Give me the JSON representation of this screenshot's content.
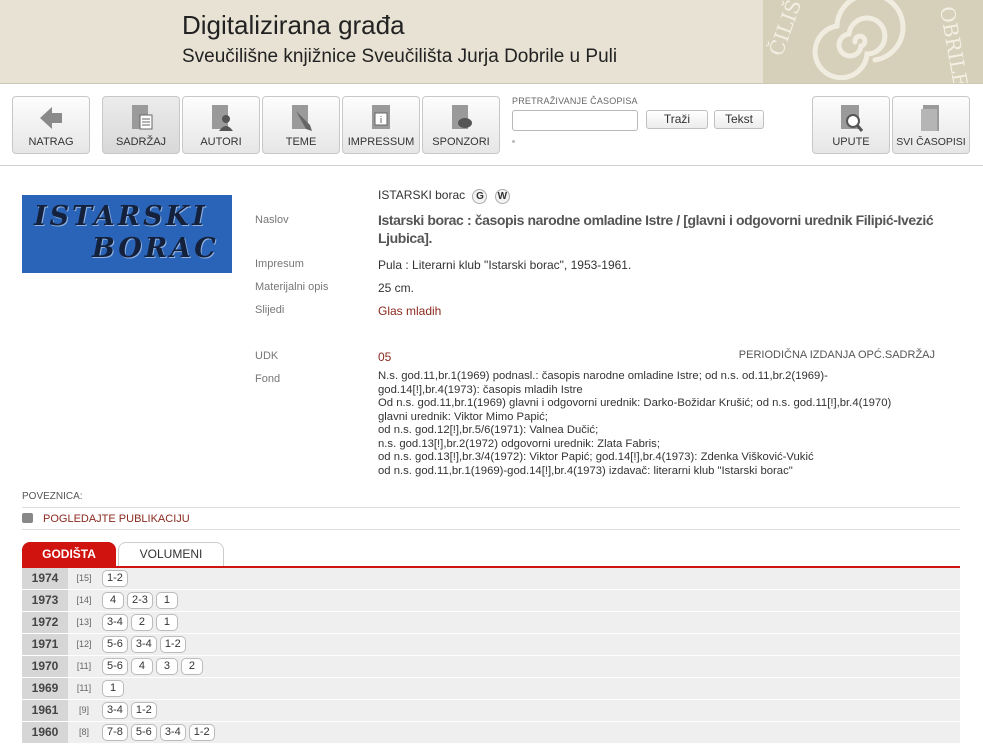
{
  "header": {
    "title": "Digitalizirana građa",
    "subtitle": "Sveučilišne knjižnice Sveučilišta Jurja Dobrile u Puli",
    "logo_text_1": "ČILIŠ",
    "logo_text_2": "OBRILE U"
  },
  "toolbar": {
    "buttons": [
      {
        "label": "NATRAG",
        "icon": "back-arrow-icon"
      },
      {
        "label": "SADRŽAJ",
        "icon": "contents-icon"
      },
      {
        "label": "AUTORI",
        "icon": "authors-icon"
      },
      {
        "label": "TEME",
        "icon": "topics-icon"
      },
      {
        "label": "IMPRESSUM",
        "icon": "info-icon"
      },
      {
        "label": "SPONZORI",
        "icon": "sponsors-icon"
      },
      {
        "label": "UPUTE",
        "icon": "help-icon"
      },
      {
        "label": "SVI ČASOPISI",
        "icon": "journals-icon"
      }
    ],
    "search": {
      "label": "PRETRAŽIVANJE ČASOPISA",
      "value": "",
      "search_button": "Traži",
      "text_button": "Tekst"
    }
  },
  "record": {
    "short_title": "ISTARSKI borac",
    "badge_g": "G",
    "badge_w": "W",
    "cover_line1": "ISTARSKI",
    "cover_line2": "BORAC",
    "fields": {
      "naslov_label": "Naslov",
      "naslov": "Istarski borac : časopis narodne omladine Istre / [glavni i odgovorni urednik Filipić-Ivezić Ljubica].",
      "impresum_label": "Impresum",
      "impresum": "Pula : Literarni klub \"Istarski borac\", 1953-1961.",
      "materijalni_label": "Materijalni opis",
      "materijalni": "25 cm.",
      "slijedi_label": "Slijedi",
      "slijedi": "Glas mladih",
      "udk_label": "UDK",
      "udk": "05",
      "udk_desc": "PERIODIČNA IZDANJA OPĆ.SADRŽAJ",
      "fond_label": "Fond",
      "fond": "N.s. god.11,br.1(1969) podnasl.: časopis narodne omladine Istre; od n.s. od.11,br.2(1969)-\ngod.14[!],br.4(1973): časopis mladih Istre\nOd n.s. god.11,br.1(1969) glavni i odgovorni urednik: Darko-Božidar Krušić; od n.s. god.11[!],br.4(1970)\nglavni urednik: Viktor Mimo Papić;\nod n.s. god.12[!],br.5/6(1971): Valnea Dučić;\nn.s. god.13[!],br.2(1972) odgovorni urednik: Zlata Fabris;\nod n.s. god.13[!],br.3/4(1972): Viktor Papić; god.14[!],br.4(1973): Zdenka Višković-Vukić\nod n.s. god.11,br.1(1969)-god.14[!],br.4(1973) izdavač: literarni klub \"Istarski borac\""
    },
    "poveznica_label": "POVEZNICA:",
    "view_publication": "POGLEDAJTE PUBLIKACIJU"
  },
  "tabs": {
    "active": "GODIŠTA",
    "inactive": "VOLUMENI"
  },
  "years": [
    {
      "year": "1974",
      "vol": "[15]",
      "issues": [
        "1-2"
      ]
    },
    {
      "year": "1973",
      "vol": "[14]",
      "issues": [
        "4",
        "2-3",
        "1"
      ]
    },
    {
      "year": "1972",
      "vol": "[13]",
      "issues": [
        "3-4",
        "2",
        "1"
      ]
    },
    {
      "year": "1971",
      "vol": "[12]",
      "issues": [
        "5-6",
        "3-4",
        "1-2"
      ]
    },
    {
      "year": "1970",
      "vol": "[11]",
      "issues": [
        "5-6",
        "4",
        "3",
        "2"
      ]
    },
    {
      "year": "1969",
      "vol": "[11]",
      "issues": [
        "1"
      ]
    },
    {
      "year": "1961",
      "vol": "[9]",
      "issues": [
        "3-4",
        "1-2"
      ]
    },
    {
      "year": "1960",
      "vol": "[8]",
      "issues": [
        "7-8",
        "5-6",
        "3-4",
        "1-2"
      ]
    }
  ]
}
